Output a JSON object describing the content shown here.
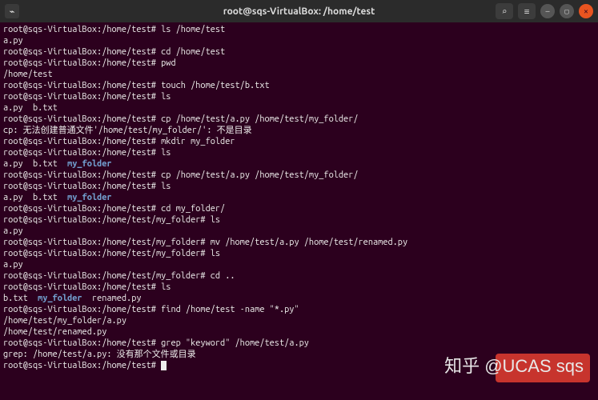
{
  "window": {
    "title": "root@sqs-VirtualBox: /home/test"
  },
  "prompt_base": "root@sqs-VirtualBox:",
  "cwd_test": "/home/test",
  "cwd_my_folder": "/home/test/my_folder",
  "lines": [
    {
      "type": "cmd",
      "cwd": "/home/test",
      "text": "ls /home/test"
    },
    {
      "type": "out",
      "text": "a.py"
    },
    {
      "type": "cmd",
      "cwd": "/home/test",
      "text": "cd /home/test"
    },
    {
      "type": "cmd",
      "cwd": "/home/test",
      "text": "pwd"
    },
    {
      "type": "out",
      "text": "/home/test"
    },
    {
      "type": "cmd",
      "cwd": "/home/test",
      "text": "touch /home/test/b.txt"
    },
    {
      "type": "cmd",
      "cwd": "/home/test",
      "text": "ls"
    },
    {
      "type": "out",
      "text": "a.py  b.txt"
    },
    {
      "type": "cmd",
      "cwd": "/home/test",
      "text": "cp /home/test/a.py /home/test/my_folder/"
    },
    {
      "type": "out",
      "text": "cp: 无法创建普通文件'/home/test/my_folder/': 不是目录"
    },
    {
      "type": "cmd",
      "cwd": "/home/test",
      "text": "mkdir my_folder"
    },
    {
      "type": "cmd",
      "cwd": "/home/test",
      "text": "ls"
    },
    {
      "type": "ls",
      "items": [
        "a.py",
        "b.txt",
        {
          "name": "my_folder",
          "dir": true
        }
      ]
    },
    {
      "type": "cmd",
      "cwd": "/home/test",
      "text": "cp /home/test/a.py /home/test/my_folder/"
    },
    {
      "type": "cmd",
      "cwd": "/home/test",
      "text": "ls"
    },
    {
      "type": "ls",
      "items": [
        "a.py",
        "b.txt",
        {
          "name": "my_folder",
          "dir": true
        }
      ]
    },
    {
      "type": "cmd",
      "cwd": "/home/test",
      "text": "cd my_folder/"
    },
    {
      "type": "cmd",
      "cwd": "/home/test/my_folder",
      "text": "ls"
    },
    {
      "type": "out",
      "text": "a.py"
    },
    {
      "type": "cmd",
      "cwd": "/home/test/my_folder",
      "text": "mv /home/test/a.py /home/test/renamed.py"
    },
    {
      "type": "cmd",
      "cwd": "/home/test/my_folder",
      "text": "ls"
    },
    {
      "type": "out",
      "text": "a.py"
    },
    {
      "type": "cmd",
      "cwd": "/home/test/my_folder",
      "text": "cd .."
    },
    {
      "type": "cmd",
      "cwd": "/home/test",
      "text": "ls"
    },
    {
      "type": "ls",
      "items": [
        "b.txt",
        {
          "name": "my_folder",
          "dir": true
        },
        "renamed.py"
      ]
    },
    {
      "type": "cmd",
      "cwd": "/home/test",
      "text": "find /home/test -name \"*.py\""
    },
    {
      "type": "out",
      "text": "/home/test/my_folder/a.py"
    },
    {
      "type": "out",
      "text": "/home/test/renamed.py"
    },
    {
      "type": "cmd",
      "cwd": "/home/test",
      "text": "grep \"keyword\" /home/test/a.py"
    },
    {
      "type": "out",
      "text": "grep: /home/test/a.py: 没有那个文件或目录"
    },
    {
      "type": "cmd",
      "cwd": "/home/test",
      "text": "",
      "cursor": true
    }
  ],
  "watermark": "知乎 @UCAS sqs",
  "icons": {
    "search": "⌕",
    "menu": "≡",
    "minimize": "—",
    "maximize": "▢",
    "close": "✕",
    "terminal": "⌁"
  }
}
